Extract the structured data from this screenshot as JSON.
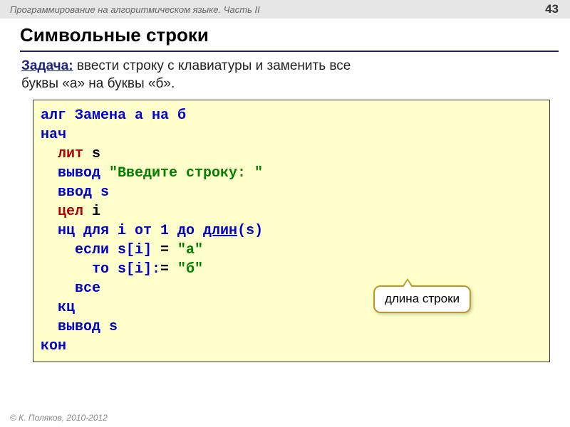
{
  "header": {
    "breadcrumb": "Программирование на алгоритмическом языке. Часть II",
    "page_number": "43"
  },
  "title": "Символьные строки",
  "task": {
    "label": "Задача:",
    "text_line1": " ввести строку с клавиатуры и заменить все",
    "text_line2": "буквы «а» на буквы «б»."
  },
  "code": {
    "l1_kw": "алг ",
    "l1_name": "Замена а на б",
    "l2": "нач",
    "l3_kw": "  лит ",
    "l3_var": "s",
    "l4_kw": "  вывод ",
    "l4_str": "\"Введите строку: \"",
    "l5": "  ввод s",
    "l6_kw": "  цел ",
    "l6_var": "i",
    "l7a": "  нц для i от 1 до ",
    "l7b": "длин",
    "l7c": "(s)",
    "l8a": "    если s[i]",
    "l8eq": " = ",
    "l8b": "\"а\"",
    "l9a": "      то s[i]:",
    "l9eq": "= ",
    "l9b": "\"б\"",
    "l10": "    все",
    "l11": "  кц",
    "l12": "  вывод s",
    "l13": "кон"
  },
  "callout": "длина строки",
  "footer": "© К. Поляков, 2010-2012"
}
